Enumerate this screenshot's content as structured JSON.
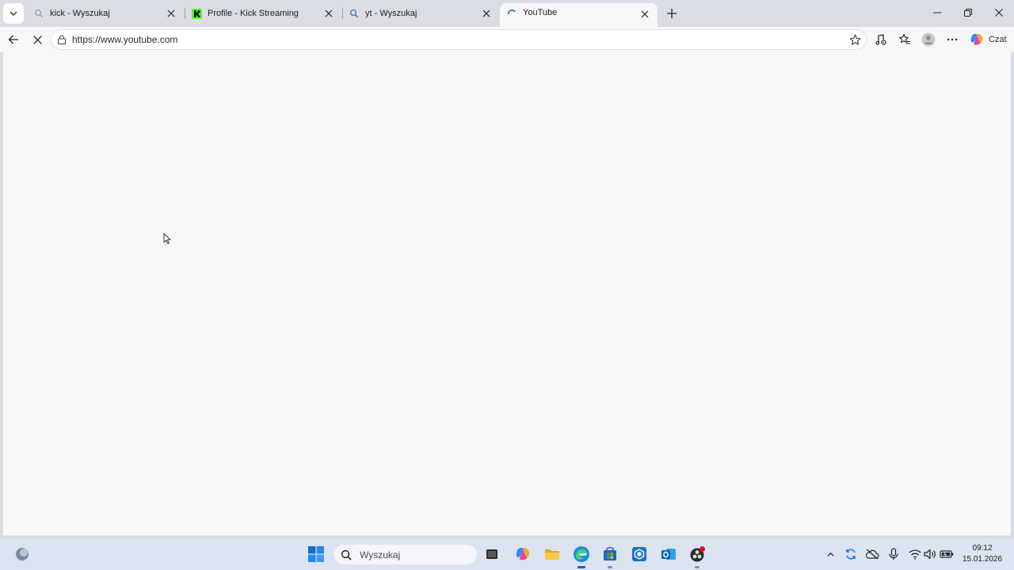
{
  "browser": {
    "tabs": [
      {
        "title": "kick - Wyszukaj",
        "icon": "search-icon",
        "active": false
      },
      {
        "title": "Profile - Kick Streaming",
        "icon": "kick-logo-icon",
        "active": false
      },
      {
        "title": "yt - Wyszukaj",
        "icon": "search-icon",
        "active": false
      },
      {
        "title": "YouTube",
        "icon": "loading-spinner-icon",
        "active": true
      }
    ],
    "address": {
      "url": "https://www.youtube.com"
    },
    "copilot_label": "Czat",
    "colors": {
      "accent": "#0067c0",
      "kick_green": "#53fc18",
      "tab_strip": "#dadde3",
      "page_bg": "#f7f7f7"
    }
  },
  "taskbar": {
    "search_placeholder": "Wyszukaj",
    "clock": {
      "time": "09:12",
      "date": "15.01.2026"
    },
    "pinned_icons": [
      "windows-start-icon",
      "search-icon",
      "task-view-icon",
      "copilot-icon",
      "file-explorer-icon",
      "edge-icon",
      "store-icon",
      "app-icon",
      "outlook-icon",
      "obs-icon"
    ],
    "tray_icons": [
      "chevron-up-icon",
      "sync-icon",
      "cloud-off-icon",
      "microphone-icon",
      "wifi-icon",
      "volume-icon",
      "battery-icon"
    ]
  }
}
